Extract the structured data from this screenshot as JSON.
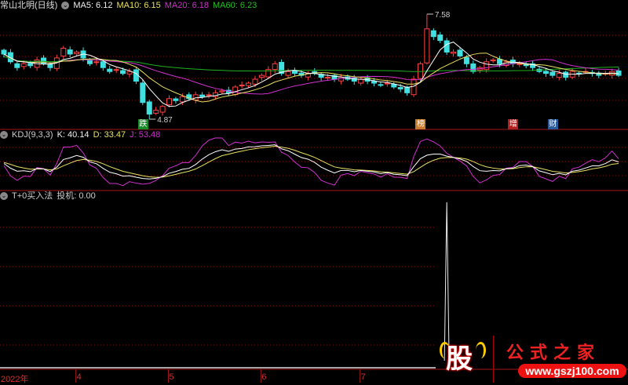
{
  "price_pane": {
    "title": "常山北明(日线)",
    "ma5": "MA5: 6.12",
    "ma10": "MA10: 6.15",
    "ma20": "MA20: 6.18",
    "ma60": "MA60: 6.23",
    "high_label": "7.58",
    "low_label": "4.87",
    "markers": [
      {
        "text": "跌",
        "index": 21,
        "color": "#1a8a2a"
      },
      {
        "text": "榜",
        "index": 63,
        "color": "#c87a2a"
      },
      {
        "text": "增",
        "index": 77,
        "color": "#b02020"
      },
      {
        "text": "财",
        "index": 83,
        "color": "#2a5a9a"
      }
    ]
  },
  "kdj_pane": {
    "title": "KDJ(9,3,3)",
    "k": "K: 40.14",
    "d": "D: 33.47",
    "j": "J: 53.48"
  },
  "t0_pane": {
    "title": "T+0买入法",
    "value": "投机: 0.00",
    "spike_index": 67
  },
  "x_axis": {
    "labels": [
      {
        "text": "2022年",
        "index": 0
      },
      {
        "text": "4",
        "index": 11
      },
      {
        "text": "5",
        "index": 25
      },
      {
        "text": "6",
        "index": 39
      },
      {
        "text": "7",
        "index": 54
      }
    ]
  },
  "watermark": {
    "icon_text": "股",
    "site": "公式之家",
    "url": "www.gszj100.com"
  },
  "colors": {
    "up": "#ff4040",
    "down": "#40e0e0",
    "ma5": "#ffffff",
    "ma10": "#e8e060",
    "ma20": "#d030d0",
    "ma60": "#20b020",
    "grid": "#8a1010"
  },
  "chart_data": {
    "type": "candlestick",
    "closes": [
      6.55,
      6.35,
      6.2,
      6.3,
      6.25,
      6.4,
      6.3,
      6.2,
      6.45,
      6.7,
      6.55,
      6.6,
      6.45,
      6.3,
      6.35,
      6.2,
      6.1,
      6.15,
      6.05,
      6.1,
      5.85,
      5.3,
      5.0,
      5.1,
      5.2,
      5.4,
      5.35,
      5.45,
      5.4,
      5.5,
      5.45,
      5.5,
      5.55,
      5.6,
      5.55,
      5.7,
      5.75,
      5.8,
      5.9,
      6.0,
      6.15,
      6.3,
      6.05,
      6.1,
      6.05,
      6.0,
      6.05,
      6.05,
      5.95,
      5.95,
      5.9,
      5.95,
      5.9,
      5.85,
      5.9,
      5.85,
      5.8,
      5.75,
      5.8,
      5.7,
      5.65,
      5.55,
      5.9,
      6.3,
      7.2,
      7.0,
      6.9,
      6.6,
      6.6,
      6.5,
      6.3,
      6.1,
      6.2,
      6.35,
      6.4,
      6.3,
      6.35,
      6.3,
      6.3,
      6.25,
      6.2,
      6.1,
      6.05,
      6.0,
      6.05,
      5.95,
      6.1,
      6.05,
      6.1,
      6.05,
      6.0,
      6.05,
      6.1,
      6.0
    ],
    "high": 7.58,
    "low": 4.87,
    "high_index": 64,
    "low_index": 22
  }
}
